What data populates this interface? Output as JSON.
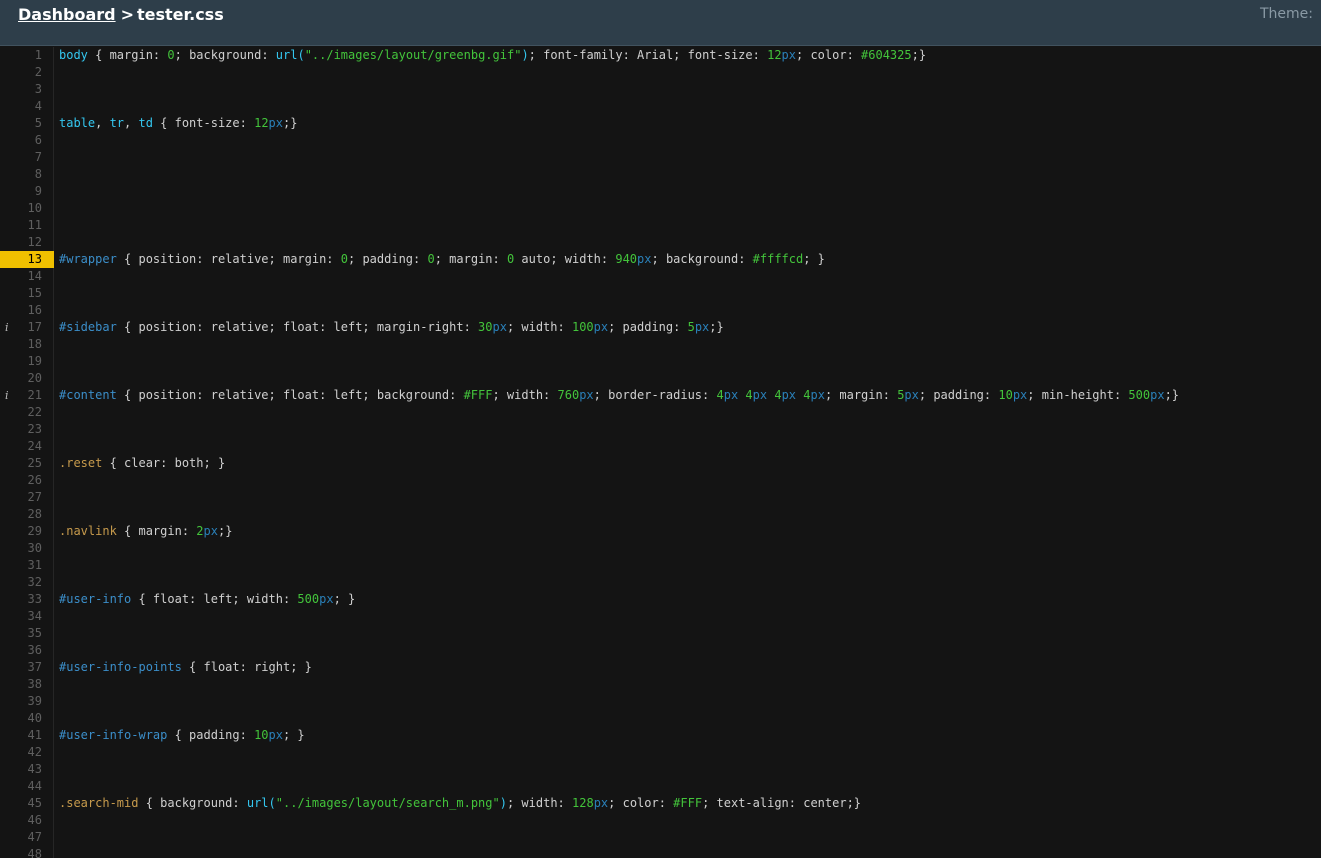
{
  "header": {
    "dashboard_link": "Dashboard",
    "separator": ">",
    "filename": "tester.css",
    "theme_label": "Theme:"
  },
  "colors": {
    "header_bg": "#2e3e4a",
    "editor_bg": "#141414",
    "active_line_marker": "#f0c000",
    "selector_tag": "#34c7f0",
    "selector_id": "#3b8ec9",
    "selector_class": "#c69a4c",
    "number": "#43c43b",
    "unit": "#2a80b9",
    "text": "#d0d0d0"
  },
  "editor": {
    "active_line": 13,
    "line_count": 48,
    "annotated_lines": [
      17,
      21
    ],
    "annotation_glyph": "i",
    "lines": [
      {
        "n": 1,
        "tokens": [
          [
            "tag",
            "body"
          ],
          [
            "plain",
            " { margin: "
          ],
          [
            "num",
            "0"
          ],
          [
            "plain",
            "; background: "
          ],
          [
            "func",
            "url("
          ],
          [
            "str",
            "\"../images/layout/greenbg.gif\""
          ],
          [
            "func",
            ")"
          ],
          [
            "plain",
            "; font-family: Arial; font-size: "
          ],
          [
            "num",
            "12"
          ],
          [
            "unit",
            "px"
          ],
          [
            "plain",
            "; color: "
          ],
          [
            "hex",
            "#604325"
          ],
          [
            "plain",
            ";}"
          ]
        ]
      },
      {
        "n": 5,
        "tokens": [
          [
            "tag",
            "table"
          ],
          [
            "plain",
            ", "
          ],
          [
            "tag",
            "tr"
          ],
          [
            "plain",
            ", "
          ],
          [
            "tag",
            "td"
          ],
          [
            "plain",
            " { font-size: "
          ],
          [
            "num",
            "12"
          ],
          [
            "unit",
            "px"
          ],
          [
            "plain",
            ";}"
          ]
        ]
      },
      {
        "n": 13,
        "tokens": [
          [
            "id",
            "#wrapper"
          ],
          [
            "plain",
            " { position: relative; margin: "
          ],
          [
            "num",
            "0"
          ],
          [
            "plain",
            "; padding: "
          ],
          [
            "num",
            "0"
          ],
          [
            "plain",
            "; margin: "
          ],
          [
            "num",
            "0"
          ],
          [
            "plain",
            " auto; width: "
          ],
          [
            "num",
            "940"
          ],
          [
            "unit",
            "px"
          ],
          [
            "plain",
            "; background: "
          ],
          [
            "hex",
            "#ffffcd"
          ],
          [
            "plain",
            "; }"
          ]
        ]
      },
      {
        "n": 17,
        "tokens": [
          [
            "id",
            "#sidebar"
          ],
          [
            "plain",
            " { position: relative; float: left; margin-right: "
          ],
          [
            "num",
            "30"
          ],
          [
            "unit",
            "px"
          ],
          [
            "plain",
            "; width: "
          ],
          [
            "num",
            "100"
          ],
          [
            "unit",
            "px"
          ],
          [
            "plain",
            "; padding: "
          ],
          [
            "num",
            "5"
          ],
          [
            "unit",
            "px"
          ],
          [
            "plain",
            ";}"
          ]
        ]
      },
      {
        "n": 21,
        "tokens": [
          [
            "id",
            "#content"
          ],
          [
            "plain",
            " { position: relative; float: left; background: "
          ],
          [
            "hex",
            "#FFF"
          ],
          [
            "plain",
            "; width: "
          ],
          [
            "num",
            "760"
          ],
          [
            "unit",
            "px"
          ],
          [
            "plain",
            "; border-radius: "
          ],
          [
            "num",
            "4"
          ],
          [
            "unit",
            "px"
          ],
          [
            "plain",
            " "
          ],
          [
            "num",
            "4"
          ],
          [
            "unit",
            "px"
          ],
          [
            "plain",
            " "
          ],
          [
            "num",
            "4"
          ],
          [
            "unit",
            "px"
          ],
          [
            "plain",
            " "
          ],
          [
            "num",
            "4"
          ],
          [
            "unit",
            "px"
          ],
          [
            "plain",
            "; margin: "
          ],
          [
            "num",
            "5"
          ],
          [
            "unit",
            "px"
          ],
          [
            "plain",
            "; padding: "
          ],
          [
            "num",
            "10"
          ],
          [
            "unit",
            "px"
          ],
          [
            "plain",
            "; min-height: "
          ],
          [
            "num",
            "500"
          ],
          [
            "unit",
            "px"
          ],
          [
            "plain",
            ";}"
          ]
        ]
      },
      {
        "n": 25,
        "tokens": [
          [
            "cls",
            ".reset"
          ],
          [
            "plain",
            " { clear: both; }"
          ]
        ]
      },
      {
        "n": 29,
        "tokens": [
          [
            "cls",
            ".navlink"
          ],
          [
            "plain",
            " { margin: "
          ],
          [
            "num",
            "2"
          ],
          [
            "unit",
            "px"
          ],
          [
            "plain",
            ";}"
          ]
        ]
      },
      {
        "n": 33,
        "tokens": [
          [
            "id",
            "#user-info"
          ],
          [
            "plain",
            " { float: left; width: "
          ],
          [
            "num",
            "500"
          ],
          [
            "unit",
            "px"
          ],
          [
            "plain",
            "; }"
          ]
        ]
      },
      {
        "n": 37,
        "tokens": [
          [
            "id",
            "#user-info-points"
          ],
          [
            "plain",
            " { float: right; }"
          ]
        ]
      },
      {
        "n": 41,
        "tokens": [
          [
            "id",
            "#user-info-wrap"
          ],
          [
            "plain",
            " { padding: "
          ],
          [
            "num",
            "10"
          ],
          [
            "unit",
            "px"
          ],
          [
            "plain",
            "; }"
          ]
        ]
      },
      {
        "n": 45,
        "tokens": [
          [
            "cls",
            ".search-mid"
          ],
          [
            "plain",
            " { background: "
          ],
          [
            "func",
            "url("
          ],
          [
            "str",
            "\"../images/layout/search_m.png\""
          ],
          [
            "func",
            ")"
          ],
          [
            "plain",
            "; width: "
          ],
          [
            "num",
            "128"
          ],
          [
            "unit",
            "px"
          ],
          [
            "plain",
            "; color: "
          ],
          [
            "hex",
            "#FFF"
          ],
          [
            "plain",
            "; text-align: center;}"
          ]
        ]
      }
    ]
  }
}
